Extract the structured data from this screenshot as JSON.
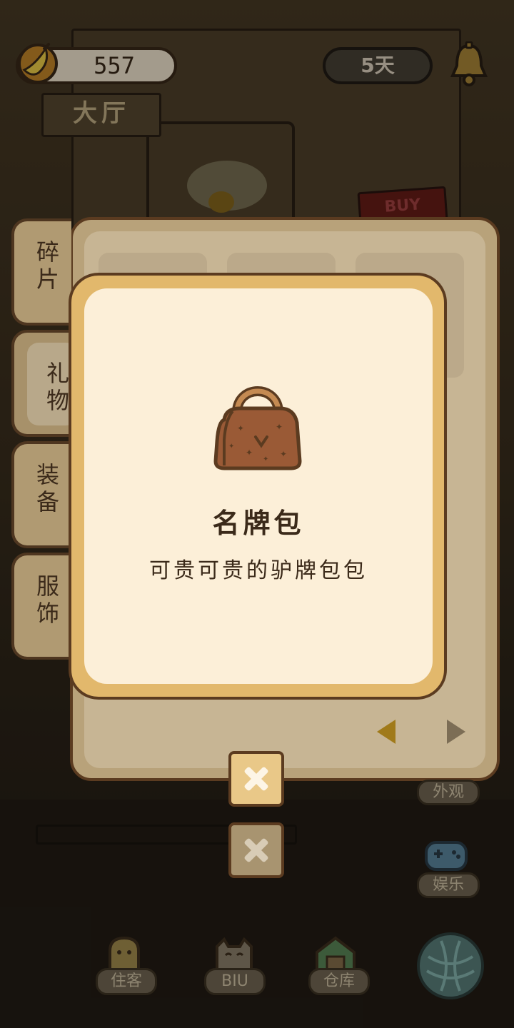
{
  "hud": {
    "banana_count": "557",
    "days": "5天",
    "room_name": "大厅"
  },
  "scene": {
    "buy_sign": "BUY"
  },
  "tabs": [
    {
      "label": "碎片",
      "active": false
    },
    {
      "label": "礼物",
      "active": true
    },
    {
      "label": "装备",
      "active": false
    },
    {
      "label": "服饰",
      "active": false
    }
  ],
  "item_dialog": {
    "name": "名牌包",
    "description": "可贵可贵的驴牌包包",
    "icon": "brand-handbag-icon"
  },
  "side_buttons": {
    "appearance": "外观",
    "entertainment": "娱乐"
  },
  "bottom_nav": [
    {
      "label": "住客",
      "icon": "guest-icon"
    },
    {
      "label": "BIU",
      "icon": "cat-icon"
    },
    {
      "label": "仓库",
      "icon": "warehouse-icon"
    }
  ],
  "colors": {
    "accent": "#e2b86c",
    "panel_border": "#5b3b20",
    "dialog_bg": "#fcefd8"
  }
}
